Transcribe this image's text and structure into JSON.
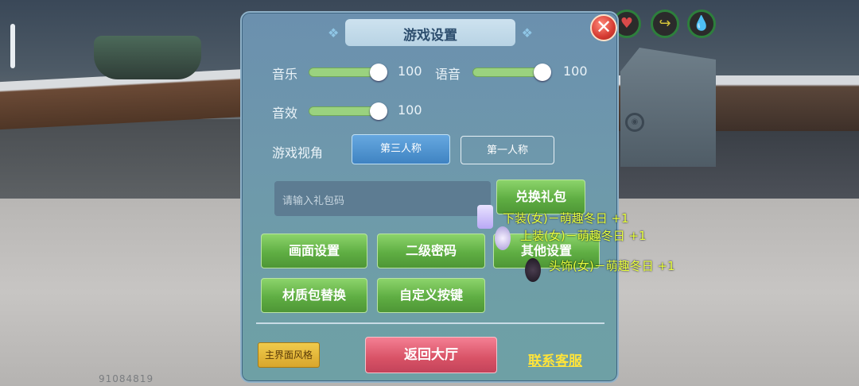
{
  "hud": {
    "uid": "91084819"
  },
  "icons": [
    "heart-icon",
    "arrow-icon",
    "drop-icon",
    "eye-icon",
    "close-icon"
  ],
  "panel": {
    "title": "游戏设置",
    "music": {
      "label": "音乐",
      "value": "100",
      "level": 1.0
    },
    "voice": {
      "label": "语音",
      "value": "100",
      "level": 1.0
    },
    "sfx": {
      "label": "音效",
      "value": "100",
      "level": 1.0
    },
    "view": {
      "label": "游戏视角",
      "third": "第三人称",
      "first": "第一人称",
      "selected": "第三人称"
    },
    "code": {
      "placeholder": "请输入礼包码",
      "button": "兑换礼包"
    },
    "buttons": {
      "graphics": "画面设置",
      "password": "二级密码",
      "other": "其他设置",
      "texture": "材质包替换",
      "keys": "自定义按键"
    },
    "footer": {
      "style": "主界面风格",
      "back": "返回大厅",
      "support": "联系客服"
    }
  },
  "rewards": [
    {
      "text": "下装(女)－萌趣冬日 +1"
    },
    {
      "text": "上装(女)－萌趣冬日 +1"
    },
    {
      "text": "头饰(女)－萌趣冬日 +1"
    }
  ],
  "colors": {
    "accent_green": "#5fae43",
    "reward_text": "#e8ff3f",
    "link_yellow": "#ffe43a",
    "close_red": "#d53b32"
  }
}
